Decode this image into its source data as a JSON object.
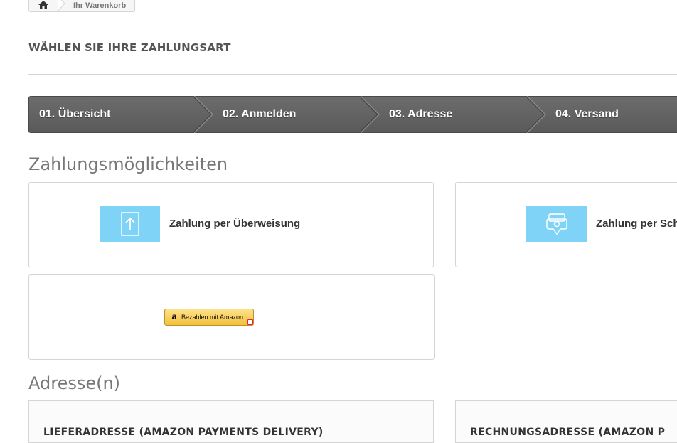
{
  "breadcrumb": {
    "home_icon": "home-icon",
    "current": "Ihr Warenkorb"
  },
  "page": {
    "heading": "WÄHLEN SIE IHRE ZAHLUNGSART"
  },
  "steps": [
    {
      "label": "01. Übersicht"
    },
    {
      "label": "02. Anmelden"
    },
    {
      "label": "03. Adresse"
    },
    {
      "label": "04. Versand"
    }
  ],
  "payment": {
    "section_title": "Zahlungsmöglichkeiten",
    "options": [
      {
        "label": "Zahlung per Überweisung",
        "icon": "bank-transfer-icon"
      },
      {
        "label": "Zahlung per Sch",
        "icon": "cheque-icon"
      }
    ],
    "amazon_button_label": "Bezahlen mit Amazon"
  },
  "addresses": {
    "section_title": "Adresse(n)",
    "delivery_title": "LIEFERADRESSE (AMAZON PAYMENTS DELIVERY)",
    "invoice_title": "RECHNUNGSADRESSE (AMAZON P"
  },
  "colors": {
    "accent_icon_bg": "#7ed3f7",
    "step_bar": "#5f5f5f"
  }
}
